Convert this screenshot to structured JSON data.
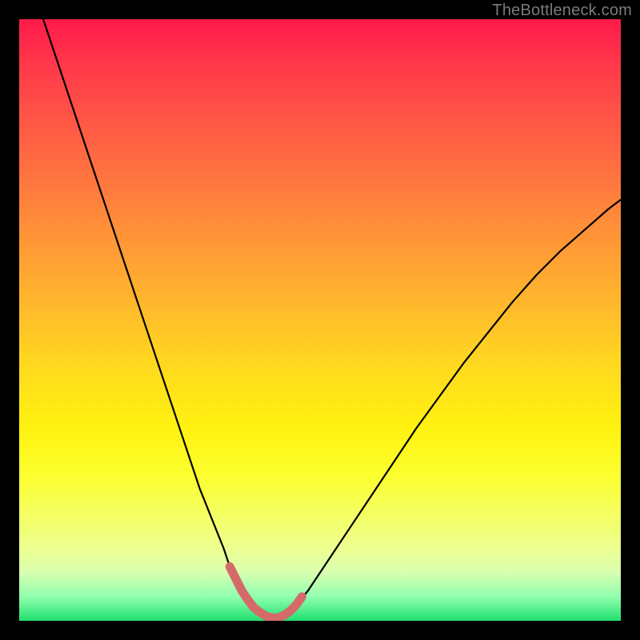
{
  "watermark": {
    "text": "TheBottleneck.com"
  },
  "colors": {
    "curve_stroke": "#000000",
    "highlight_stroke": "#d46a6a",
    "gradient_top": "#ff1a4a",
    "gradient_bottom": "#20e070",
    "frame": "#000000"
  },
  "chart_data": {
    "type": "line",
    "title": "",
    "xlabel": "",
    "ylabel": "",
    "xlim": [
      0,
      100
    ],
    "ylim": [
      0,
      100
    ],
    "grid": false,
    "legend": false,
    "series": [
      {
        "name": "bottleneck-curve",
        "x": [
          4,
          6,
          8,
          10,
          12,
          14,
          16,
          18,
          20,
          22,
          24,
          26,
          28,
          30,
          32,
          34,
          35,
          36,
          37,
          38,
          39,
          40,
          41,
          42,
          43,
          44,
          45,
          46,
          48,
          50,
          52,
          55,
          58,
          62,
          66,
          70,
          74,
          78,
          82,
          86,
          90,
          94,
          98,
          100
        ],
        "y": [
          100,
          94,
          88,
          82,
          76,
          70,
          64,
          58,
          52,
          46,
          40,
          34,
          28,
          22,
          17,
          12,
          9,
          7,
          5,
          3.5,
          2.2,
          1.4,
          0.8,
          0.5,
          0.5,
          0.9,
          1.6,
          2.6,
          5,
          8,
          11,
          15.5,
          20,
          26,
          32,
          37.5,
          43,
          48,
          53,
          57.5,
          61.5,
          65,
          68.5,
          70
        ]
      },
      {
        "name": "bottleneck-highlight",
        "x": [
          35,
          36,
          37,
          38,
          39,
          40,
          41,
          42,
          43,
          44,
          45,
          46,
          47
        ],
        "y": [
          9,
          7,
          5,
          3.5,
          2.2,
          1.4,
          0.8,
          0.5,
          0.5,
          0.9,
          1.6,
          2.6,
          4
        ]
      }
    ]
  }
}
